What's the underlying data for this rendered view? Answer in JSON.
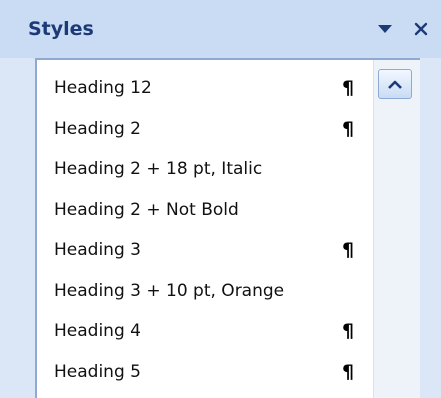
{
  "pane": {
    "title": "Styles"
  },
  "styles_list": {
    "items": [
      {
        "label": "Heading 12",
        "para_mark": "¶"
      },
      {
        "label": "Heading 2",
        "para_mark": "¶"
      },
      {
        "label": "Heading 2 + 18 pt, Italic",
        "para_mark": ""
      },
      {
        "label": "Heading 2 + Not Bold",
        "para_mark": ""
      },
      {
        "label": "Heading 3",
        "para_mark": "¶"
      },
      {
        "label": "Heading 3 + 10 pt, Orange",
        "para_mark": ""
      },
      {
        "label": "Heading 4",
        "para_mark": "¶"
      },
      {
        "label": "Heading 5",
        "para_mark": "¶"
      }
    ]
  },
  "icons": {
    "dropdown": "chevron-down-icon",
    "close": "close-icon",
    "scroll_up": "scroll-up-arrow-icon"
  },
  "colors": {
    "title_text": "#1d3a78",
    "pane_background": "#dbe7f7",
    "list_background": "#ffffff"
  }
}
